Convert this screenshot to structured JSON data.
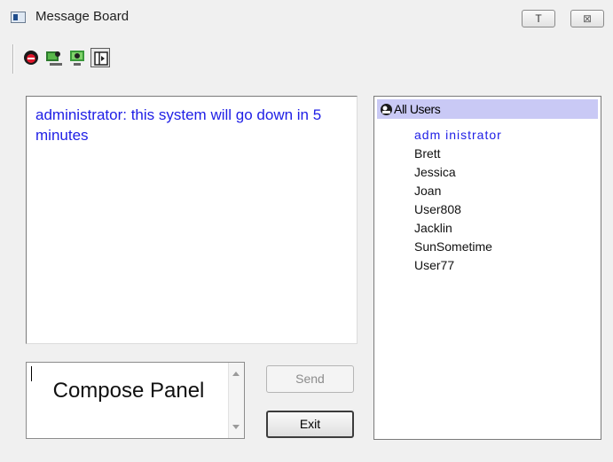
{
  "window": {
    "title": "Message Board",
    "controls": {
      "minimize_label": "T",
      "close_label": "⊠"
    }
  },
  "toolbar": {
    "icons": [
      "person-stop-icon",
      "computer-user-icon",
      "computer-screen-icon",
      "toggle-panel-icon"
    ]
  },
  "messages": {
    "text": "administrator: this system will go down in 5 minutes",
    "color": "#2020e6"
  },
  "compose": {
    "label": "Compose Panel"
  },
  "buttons": {
    "send": "Send",
    "exit": "Exit"
  },
  "users": {
    "header": "All Users",
    "header_highlight": "#c9c9f5",
    "items": [
      {
        "name": "adm inistrator",
        "current": true
      },
      {
        "name": "Brett"
      },
      {
        "name": "Jessica"
      },
      {
        "name": "Joan"
      },
      {
        "name": "User808"
      },
      {
        "name": "Jacklin"
      },
      {
        "name": "SunSometime"
      },
      {
        "name": "User77"
      }
    ]
  }
}
